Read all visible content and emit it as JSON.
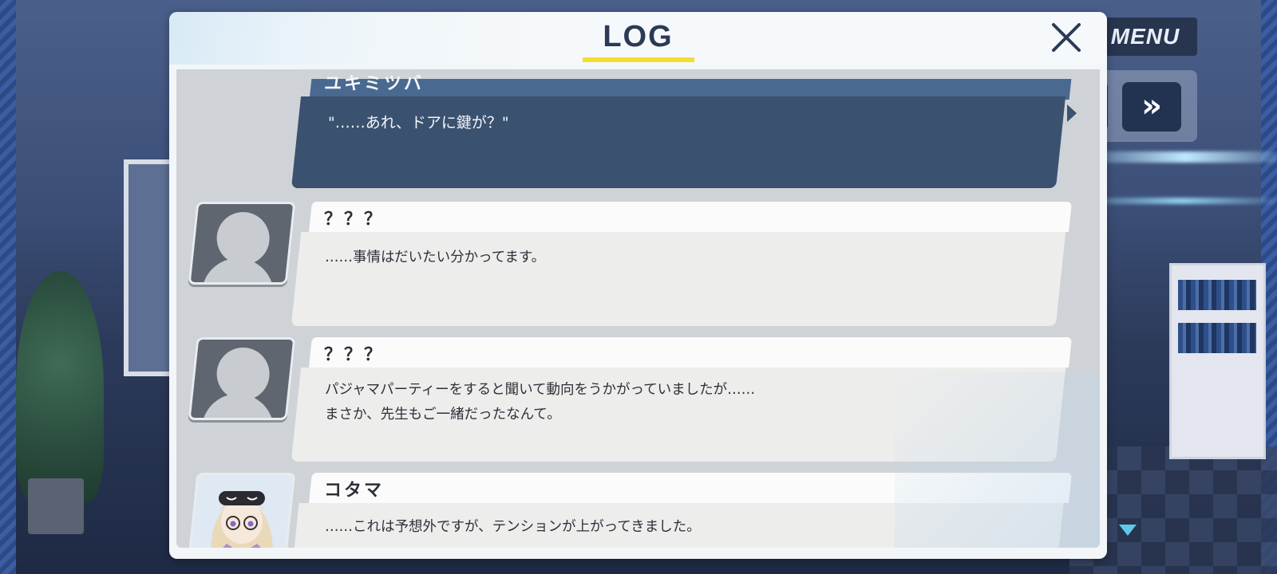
{
  "hud": {
    "menu_label": "MENU",
    "fast_forward_glyph": "»",
    "advance_icon": "triangle-down"
  },
  "log": {
    "title": "LOG",
    "close_glyph": "close-x",
    "entries": [
      {
        "speaker": "ユキミツバ",
        "lines": [
          "\"……あれ、ドアに鍵が？\""
        ],
        "avatar": "none",
        "highlighted": true
      },
      {
        "speaker": "？？？",
        "lines": [
          "……事情はだいたい分かってます。"
        ],
        "avatar": "silhouette"
      },
      {
        "speaker": "？？？",
        "lines": [
          "パジャマパーティーをすると聞いて動向をうかがっていましたが……",
          "まさか、先生もご一緒だったなんて。"
        ],
        "avatar": "silhouette"
      },
      {
        "speaker": "コタマ",
        "lines": [
          "……これは予想外ですが、テンションが上がってきました。"
        ],
        "avatar": "character-portrait"
      }
    ]
  },
  "colors": {
    "title_underline": "#f5dd2f",
    "highlight_box": "#3a5170",
    "entry_box": "#ededec"
  }
}
